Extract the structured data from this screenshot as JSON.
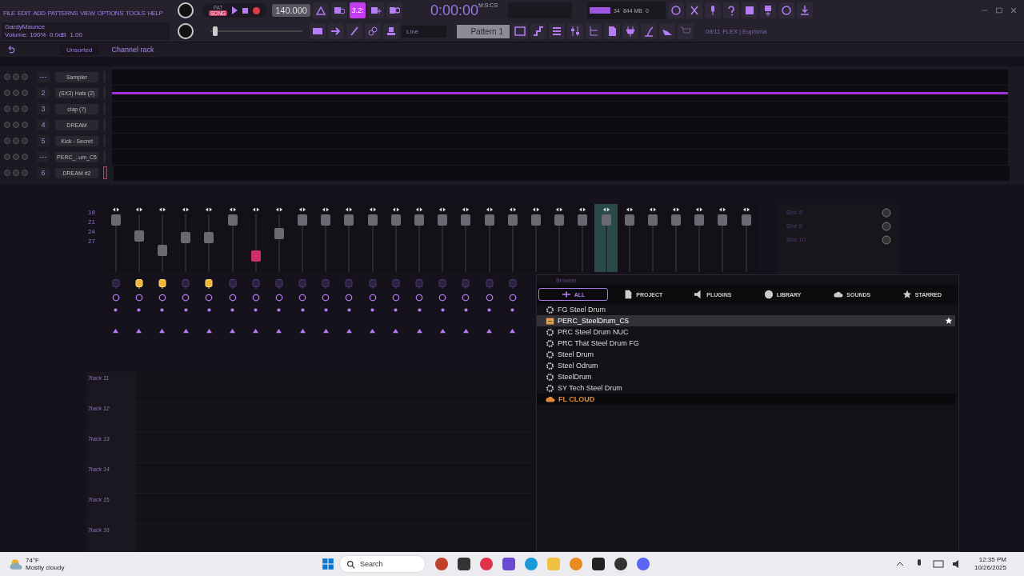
{
  "menu": [
    "FILE",
    "EDIT",
    "ADD",
    "PATTERNS",
    "VIEW",
    "OPTIONS",
    "TOOLS",
    "HELP"
  ],
  "transport": {
    "modes": [
      {
        "label": "PAT",
        "selected": false
      },
      {
        "label": "SONG",
        "selected": true
      }
    ],
    "recording": true,
    "tempo": "140.000",
    "time": "0:00:00",
    "time_unit": "M:S:CS",
    "cpu": "34",
    "memory": "844 MB",
    "voices": "0"
  },
  "toggles": [
    {
      "kind": "metronome",
      "on": false
    },
    {
      "kind": "wait",
      "on": false
    },
    {
      "kind": "countdown",
      "label": "3.2:",
      "on": true
    },
    {
      "kind": "overdub",
      "on": false
    },
    {
      "kind": "loop",
      "on": false
    }
  ],
  "hint": {
    "title": "GardyMaunce",
    "text": "Volume: 100%  0.0dB  1.00"
  },
  "master_pitch": {
    "level": 0.05
  },
  "snap": "Line",
  "pattern": "Pattern 1",
  "news": {
    "count": "09/11",
    "text": "FLEX | Euphoria"
  },
  "rack_header": {
    "filter": "Unsorted",
    "title": "Channel rack"
  },
  "channels": [
    {
      "number": "---",
      "name": "Sampler",
      "has_notes": false,
      "selected": false
    },
    {
      "number": "2",
      "name": "(SX3) Hats (2)",
      "has_notes": true,
      "selected": false
    },
    {
      "number": "3",
      "name": "clap (7)",
      "has_notes": false,
      "selected": false
    },
    {
      "number": "4",
      "name": "DREAM",
      "has_notes": false,
      "selected": false
    },
    {
      "number": "5",
      "name": "Kick - Secret",
      "has_notes": false,
      "selected": false
    },
    {
      "number": "---",
      "name": "PERC_..um_C5",
      "has_notes": false,
      "selected": false
    },
    {
      "number": "6",
      "name": "DREAM #2",
      "has_notes": false,
      "selected": true
    }
  ],
  "mixer": {
    "scale": [
      "18",
      "21",
      "24",
      "27"
    ],
    "strips": [
      {
        "level": 0.9,
        "fx": false,
        "armed": false,
        "selected": false
      },
      {
        "level": 0.62,
        "fx": true,
        "armed": false,
        "selected": false
      },
      {
        "level": 0.38,
        "fx": true,
        "armed": false,
        "selected": false
      },
      {
        "level": 0.6,
        "fx": false,
        "armed": false,
        "selected": false
      },
      {
        "level": 0.6,
        "fx": true,
        "armed": false,
        "selected": false
      },
      {
        "level": 0.9,
        "fx": false,
        "armed": false,
        "selected": false
      },
      {
        "level": 0.28,
        "fx": false,
        "armed": true,
        "selected": false
      },
      {
        "level": 0.66,
        "fx": false,
        "armed": false,
        "selected": false
      },
      {
        "level": 0.9,
        "fx": false,
        "armed": false,
        "selected": false
      },
      {
        "level": 0.9,
        "fx": false,
        "armed": false,
        "selected": false
      },
      {
        "level": 0.9,
        "fx": false,
        "armed": false,
        "selected": false
      },
      {
        "level": 0.9,
        "fx": false,
        "armed": false,
        "selected": false
      },
      {
        "level": 0.9,
        "fx": false,
        "armed": false,
        "selected": false
      },
      {
        "level": 0.9,
        "fx": false,
        "armed": false,
        "selected": false
      },
      {
        "level": 0.9,
        "fx": false,
        "armed": false,
        "selected": false
      },
      {
        "level": 0.9,
        "fx": false,
        "armed": false,
        "selected": false
      },
      {
        "level": 0.9,
        "fx": false,
        "armed": false,
        "selected": false
      },
      {
        "level": 0.9,
        "fx": false,
        "armed": false,
        "selected": false
      },
      {
        "level": 0.9,
        "armed": false,
        "selected": false
      },
      {
        "level": 0.9,
        "armed": false,
        "selected": false
      },
      {
        "level": 0.9,
        "armed": false,
        "selected": false
      },
      {
        "level": 0.9,
        "armed": false,
        "selected": true
      },
      {
        "level": 0.9,
        "armed": false,
        "selected": false
      },
      {
        "level": 0.9,
        "armed": false,
        "selected": false
      },
      {
        "level": 0.9,
        "armed": false,
        "selected": false
      },
      {
        "level": 0.9,
        "armed": false,
        "selected": false
      },
      {
        "level": 0.9,
        "armed": false,
        "selected": false
      },
      {
        "level": 0.9,
        "armed": false,
        "selected": false
      }
    ],
    "slots": [
      "Slot 8",
      "Slot 9",
      "Slot 10"
    ]
  },
  "playlist": {
    "tracks": [
      "Track 11",
      "Track 12",
      "Track 13",
      "Track 14",
      "Track 15",
      "Track 16"
    ]
  },
  "browser": {
    "title": "Browser",
    "tabs": [
      {
        "kind": "all",
        "label": "ALL",
        "selected": true
      },
      {
        "kind": "project",
        "label": "PROJECT",
        "selected": false
      },
      {
        "kind": "plugins",
        "label": "PLUGINS",
        "selected": false
      },
      {
        "kind": "library",
        "label": "LIBRARY",
        "selected": false
      },
      {
        "kind": "sounds",
        "label": "SOUNDS",
        "selected": false
      },
      {
        "kind": "starred",
        "label": "STARRED",
        "selected": false
      }
    ],
    "items": [
      {
        "kind": "preset",
        "label": "FG Steel Drum",
        "selected": false,
        "starred": false
      },
      {
        "kind": "sample",
        "label": "PERC_SteelDrum_C5",
        "selected": true,
        "starred": true
      },
      {
        "kind": "preset",
        "label": "PRC Steel Drum NUC",
        "selected": false,
        "starred": false
      },
      {
        "kind": "preset",
        "label": "PRC That Steel Drum FG",
        "selected": false,
        "starred": false
      },
      {
        "kind": "preset",
        "label": "Steel Drum",
        "selected": false,
        "starred": false
      },
      {
        "kind": "preset",
        "label": "Steel Odrum",
        "selected": false,
        "starred": false
      },
      {
        "kind": "preset",
        "label": "SteelDrum",
        "selected": false,
        "starred": false
      },
      {
        "kind": "preset",
        "label": "SY Tech Steel Drum",
        "selected": false,
        "starred": false
      },
      {
        "kind": "cloud",
        "label": "FL CLOUD",
        "selected": false,
        "starred": false
      }
    ]
  },
  "taskbar": {
    "weather": {
      "temp": "74°F",
      "text": "Mostly cloudy"
    },
    "search": "Search",
    "time": "12:35 PM",
    "date": "10/26/2025"
  }
}
